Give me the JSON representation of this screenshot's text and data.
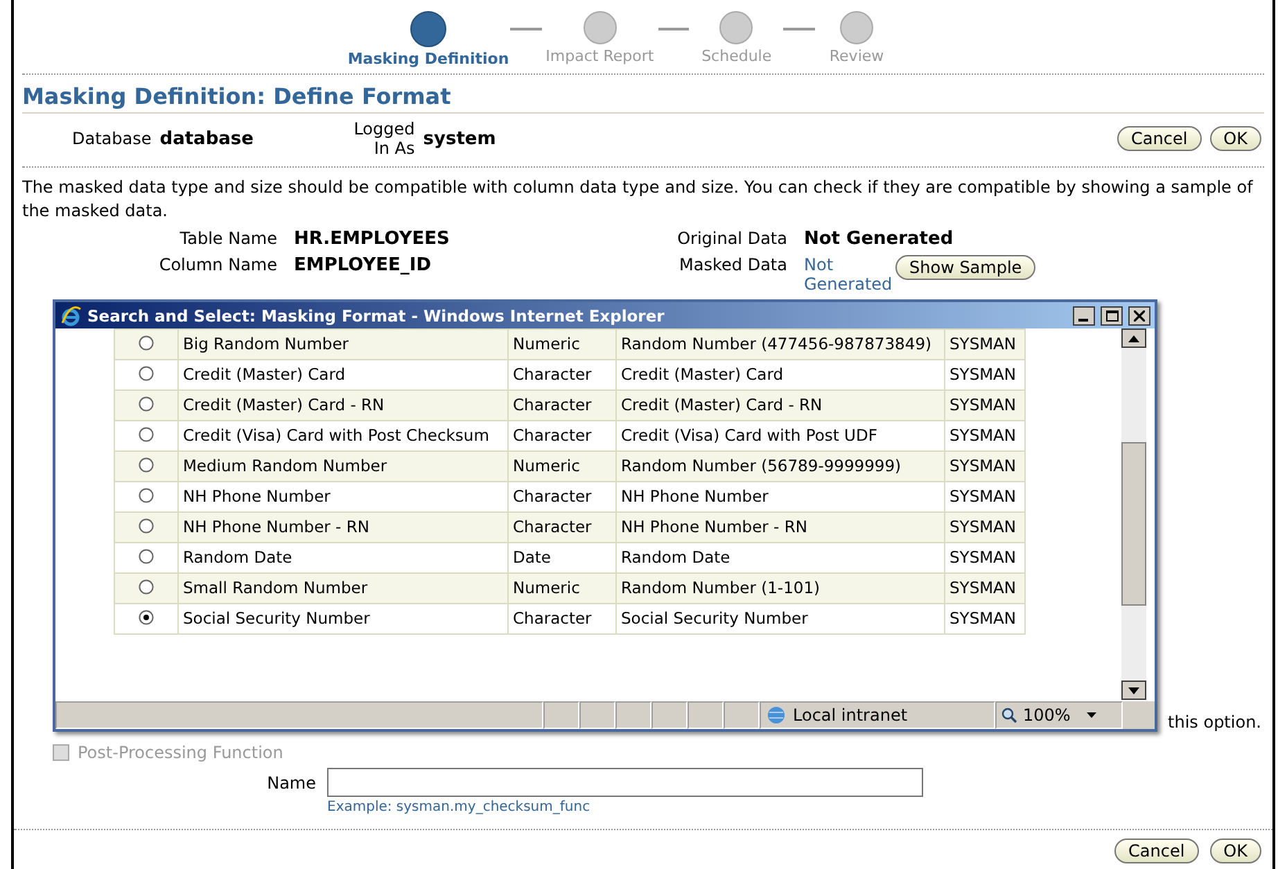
{
  "wizard": {
    "steps": [
      {
        "label": "Masking Definition",
        "selected": true
      },
      {
        "label": "Impact Report",
        "selected": false
      },
      {
        "label": "Schedule",
        "selected": false
      },
      {
        "label": "Review",
        "selected": false
      }
    ]
  },
  "header": {
    "title": "Masking Definition: Define Format",
    "database_label": "Database",
    "database": "database",
    "user_label": "Logged In As",
    "user": "system",
    "buttons": [
      "Cancel",
      "OK"
    ]
  },
  "instructions": "The masked data type and size should be compatible with column data type and size. You can check if they are compatible by showing a sample of the masked data.",
  "details": {
    "left": [
      {
        "label": "Table Name",
        "value": "HR.EMPLOYEES"
      },
      {
        "label": "Column Name",
        "value": "EMPLOYEE_ID"
      }
    ],
    "right": [
      {
        "label": "Original Data",
        "value": "Not Generated",
        "kind": "text"
      },
      {
        "label": "Masked Data",
        "value": "Not Generated",
        "kind": "link"
      }
    ],
    "sample_button": "Show Sample"
  },
  "popup": {
    "title": "Search and Select: Masking Format - Windows Internet Explorer",
    "rows": [
      {
        "name": "Big Random Number",
        "type": "Numeric",
        "description": "Random Number (477456-987873849)",
        "owner": "SYSMAN",
        "selected": false
      },
      {
        "name": "Credit (Master) Card",
        "type": "Character",
        "description": "Credit (Master) Card",
        "owner": "SYSMAN",
        "selected": false
      },
      {
        "name": "Credit (Master) Card - RN",
        "type": "Character",
        "description": "Credit (Master) Card - RN",
        "owner": "SYSMAN",
        "selected": false
      },
      {
        "name": "Credit (Visa) Card with Post Checksum",
        "type": "Character",
        "description": "Credit (Visa) Card with Post UDF",
        "owner": "SYSMAN",
        "selected": false
      },
      {
        "name": "Medium Random Number",
        "type": "Numeric",
        "description": "Random Number (56789-9999999)",
        "owner": "SYSMAN",
        "selected": false
      },
      {
        "name": "NH Phone Number",
        "type": "Character",
        "description": "NH Phone Number",
        "owner": "SYSMAN",
        "selected": false
      },
      {
        "name": "NH Phone Number - RN",
        "type": "Character",
        "description": "NH Phone Number - RN",
        "owner": "SYSMAN",
        "selected": false
      },
      {
        "name": "Random Date",
        "type": "Date",
        "description": "Random Date",
        "owner": "SYSMAN",
        "selected": false
      },
      {
        "name": "Small Random Number",
        "type": "Numeric",
        "description": "Random Number (1-101)",
        "owner": "SYSMAN",
        "selected": false
      },
      {
        "name": "Social Security Number",
        "type": "Character",
        "description": "Social Security Number",
        "owner": "SYSMAN",
        "selected": true
      }
    ],
    "zone": "Local intranet",
    "zoom": "100%"
  },
  "hidden_text_tail": "this option.",
  "post_processing": {
    "label": "Post-Processing Function",
    "checked": false,
    "disabled": true,
    "name_label": "Name",
    "example": "Example: sysman.my_checksum_func"
  },
  "footer_buttons": [
    "Cancel",
    "OK"
  ]
}
